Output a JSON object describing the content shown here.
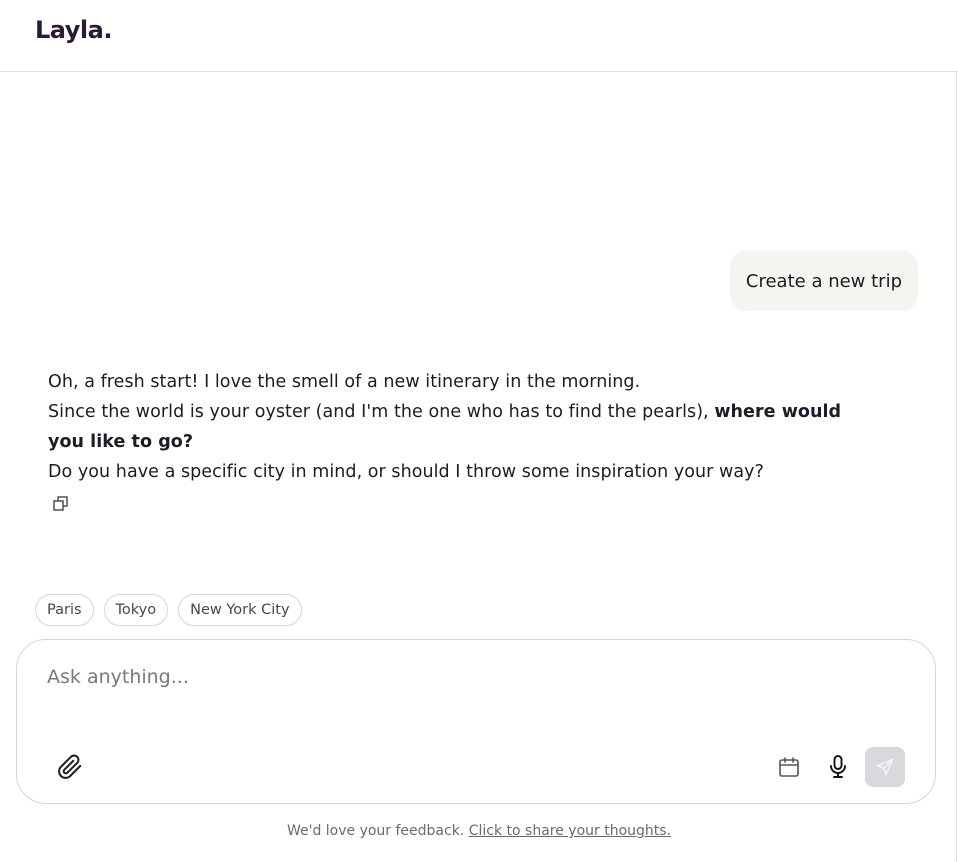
{
  "app": {
    "logo_text": "Layla."
  },
  "conversation": {
    "user_message": "Create a new trip",
    "assistant": {
      "line1": "Oh, a fresh start! I love the smell of a new itinerary in the morning.",
      "line2_plain": "Since the world is your oyster (and I'm the one who has to find the pearls), ",
      "line2_bold": "where would",
      "line3_bold": "you like to go?",
      "line4": "Do you have a specific city in mind, or should I throw some inspiration your way?"
    }
  },
  "suggestions": [
    {
      "label": "Paris"
    },
    {
      "label": "Tokyo"
    },
    {
      "label": "New York City"
    }
  ],
  "composer": {
    "placeholder": "Ask anything..."
  },
  "footer": {
    "text": "We'd love your feedback. ",
    "link": "Click to share your thoughts."
  },
  "icons": {
    "copy": "copy-icon",
    "attach": "paperclip-icon",
    "calendar": "calendar-icon",
    "mic": "microphone-icon",
    "send": "send-icon"
  },
  "colors": {
    "brand": "#2b1b33",
    "user_bubble": "#f6f4ef",
    "send_disabled": "#d7d9dd"
  }
}
